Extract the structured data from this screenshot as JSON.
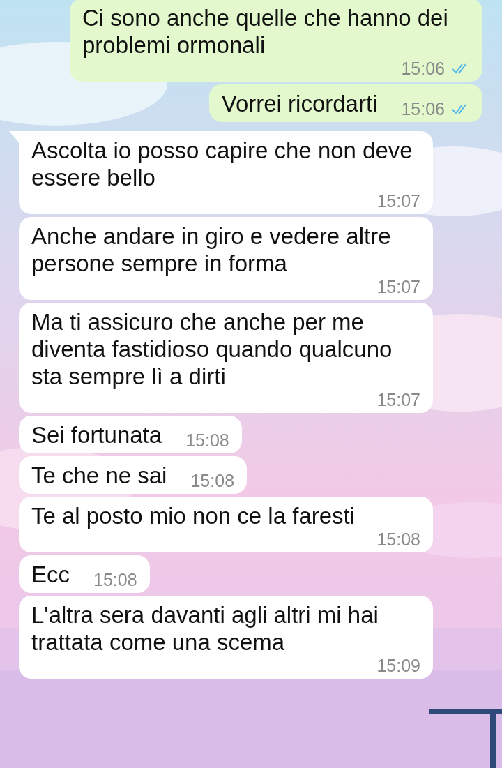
{
  "messages": [
    {
      "kind": "out",
      "text": "Ci sono anche quelle che hanno dei problemi ormonali",
      "time": "15:06",
      "read": true,
      "tail": false
    },
    {
      "kind": "out",
      "text": "Vorrei ricordarti",
      "time": "15:06",
      "read": true,
      "tail": false
    },
    {
      "kind": "in",
      "text": "Ascolta io posso capire che non deve essere bello",
      "time": "15:07",
      "tail": true
    },
    {
      "kind": "in",
      "text": "Anche andare in giro e vedere altre persone sempre in forma",
      "time": "15:07",
      "tail": false
    },
    {
      "kind": "in",
      "text": "Ma ti assicuro che anche per me diventa fastidioso quando qualcuno sta sempre lì a dirti",
      "time": "15:07",
      "tail": false
    },
    {
      "kind": "in",
      "text": "Sei fortunata",
      "time": "15:08",
      "tail": false
    },
    {
      "kind": "in",
      "text": "Te che ne sai",
      "time": "15:08",
      "tail": false
    },
    {
      "kind": "in",
      "text": "Te al posto mio non ce la faresti",
      "time": "15:08",
      "tail": false
    },
    {
      "kind": "in",
      "text": "Ecc",
      "time": "15:08",
      "tail": false
    },
    {
      "kind": "in",
      "text": "L'altra sera davanti agli altri mi hai trattata come una scema",
      "time": "15:09",
      "tail": false
    }
  ]
}
